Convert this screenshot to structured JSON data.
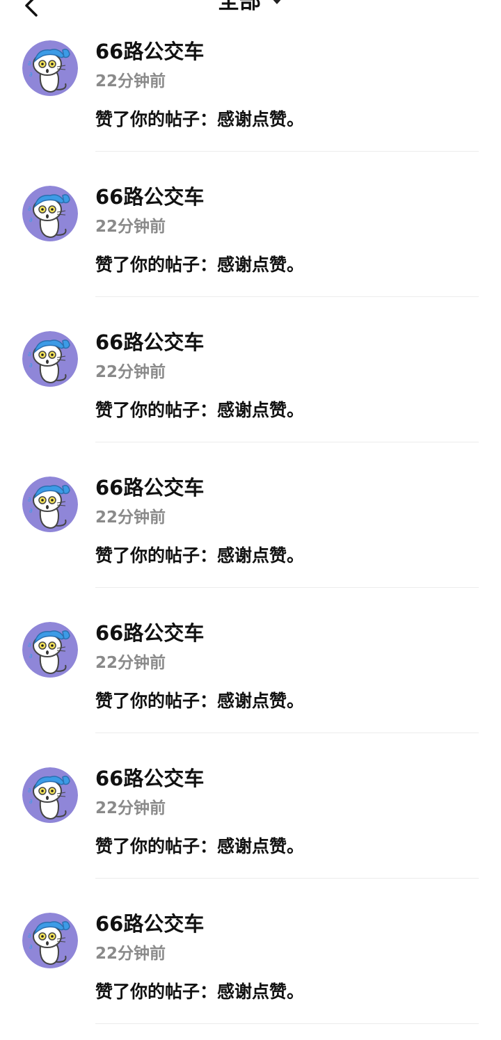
{
  "header": {
    "title": "全部",
    "back_icon": "chevron-left-icon",
    "dropdown_icon": "caret-down-icon"
  },
  "notifications": [
    {
      "user": "66路公交车",
      "time": "22分钟前",
      "message": "赞了你的帖子：感谢点赞。",
      "avatar": "cartoon-cat-avatar"
    },
    {
      "user": "66路公交车",
      "time": "22分钟前",
      "message": "赞了你的帖子：感谢点赞。",
      "avatar": "cartoon-cat-avatar"
    },
    {
      "user": "66路公交车",
      "time": "22分钟前",
      "message": "赞了你的帖子：感谢点赞。",
      "avatar": "cartoon-cat-avatar"
    },
    {
      "user": "66路公交车",
      "time": "22分钟前",
      "message": "赞了你的帖子：感谢点赞。",
      "avatar": "cartoon-cat-avatar"
    },
    {
      "user": "66路公交车",
      "time": "22分钟前",
      "message": "赞了你的帖子：感谢点赞。",
      "avatar": "cartoon-cat-avatar"
    },
    {
      "user": "66路公交车",
      "time": "22分钟前",
      "message": "赞了你的帖子：感谢点赞。",
      "avatar": "cartoon-cat-avatar"
    },
    {
      "user": "66路公交车",
      "time": "22分钟前",
      "message": "赞了你的帖子：感谢点赞。",
      "avatar": "cartoon-cat-avatar"
    }
  ],
  "colors": {
    "avatar_bg": "#8f86d8",
    "hat": "#3c9be6",
    "time_text": "#8a8a8a",
    "divider": "#ececec"
  }
}
